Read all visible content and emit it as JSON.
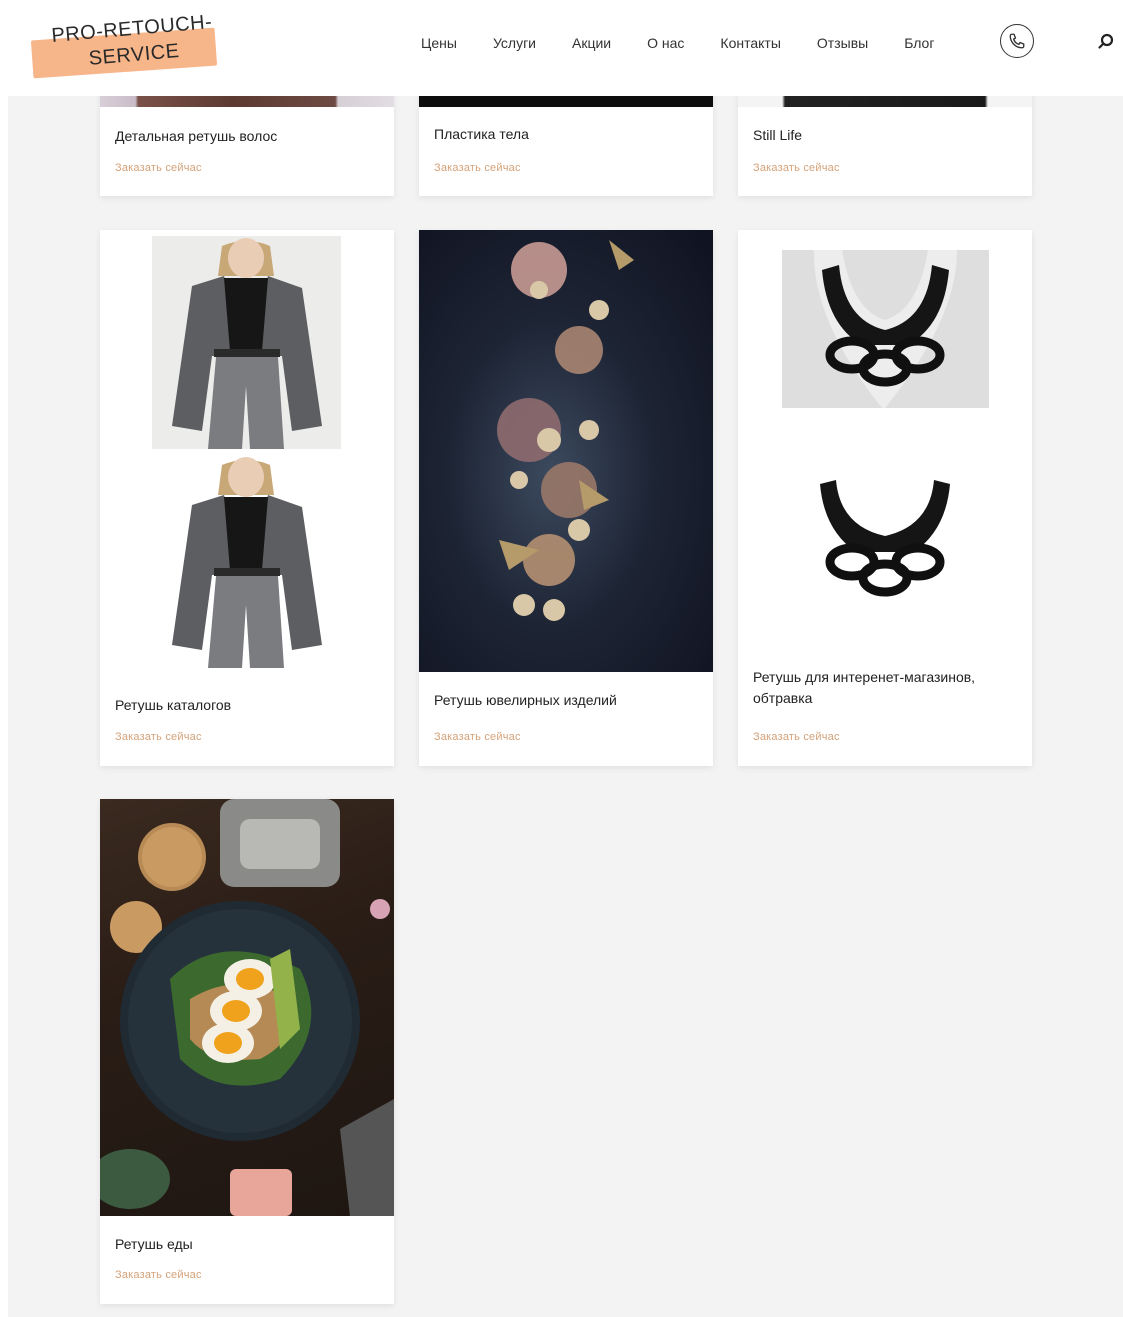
{
  "brand": {
    "line1": "PRO-RETOUCH-",
    "line2": "SERVICE",
    "accent": "#f7b58a"
  },
  "nav": {
    "items": [
      "Цены",
      "Услуги",
      "Акции",
      "О нас",
      "Контакты",
      "Отзывы",
      "Блог"
    ]
  },
  "icons": {
    "phone": "phone-icon",
    "search": "search-icon"
  },
  "cta_color": "#d4a27a",
  "cards": [
    {
      "title": "Детальная ретушь волос",
      "cta": "Заказать сейчас"
    },
    {
      "title": "Пластика тела",
      "cta": "Заказать сейчас"
    },
    {
      "title": "Still Life",
      "cta": "Заказать сейчас"
    },
    {
      "title": "Ретушь каталогов",
      "cta": "Заказать сейчас"
    },
    {
      "title": "Ретушь ювелирных изделий",
      "cta": "Заказать сейчас"
    },
    {
      "title": "Ретушь для интеренет-магазинов, обтравка",
      "cta": "Заказать сейчас"
    },
    {
      "title": "Ретушь еды",
      "cta": "Заказать сейчас"
    }
  ]
}
